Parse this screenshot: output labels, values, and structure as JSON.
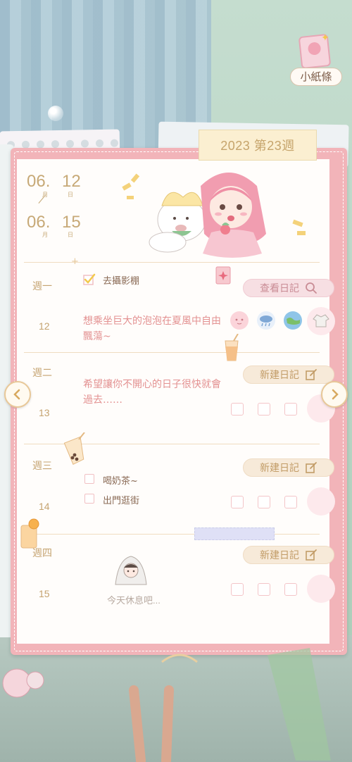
{
  "note_button": {
    "label": "小紙條",
    "icon": "note-avatar-icon"
  },
  "planner": {
    "week_tab": "2023 第23週",
    "date_range": {
      "start_month": "06.",
      "start_day": "12",
      "end_month": "06.",
      "end_day": "15",
      "month_unit": "月",
      "day_unit": "日"
    },
    "days": [
      {
        "name": "週一",
        "num": "12",
        "todos": [
          {
            "text": "去攝影棚",
            "checked": true
          }
        ],
        "note": "想乘坐巨大的泡泡在夏風中自由飄蕩~",
        "diary_button": "查看日記",
        "diary_icon": "search-icon",
        "moods": [
          "pink-face-icon",
          "rain-cloud-icon",
          "earth-icon",
          "clothes-icon"
        ]
      },
      {
        "name": "週二",
        "num": "13",
        "todos": [],
        "note": "希望讓你不開心的日子很快就會過去……",
        "diary_button": "新建日記",
        "diary_icon": "edit-icon"
      },
      {
        "name": "週三",
        "num": "14",
        "todos": [
          {
            "text": "喝奶茶~",
            "checked": false
          },
          {
            "text": "出門逛街",
            "checked": false
          }
        ],
        "note": "",
        "diary_button": "新建日記",
        "diary_icon": "edit-icon"
      },
      {
        "name": "週四",
        "num": "15",
        "todos": [],
        "note": "",
        "diary_button": "新建日記",
        "diary_icon": "edit-icon",
        "rest_text": "今天休息吧..."
      }
    ]
  },
  "nav": {
    "prev_icon": "chevron-left-icon",
    "next_icon": "chevron-right-icon"
  },
  "colors": {
    "accent": "#c7a977",
    "pink": "#f2b4b9",
    "note_text": "#e39191"
  }
}
